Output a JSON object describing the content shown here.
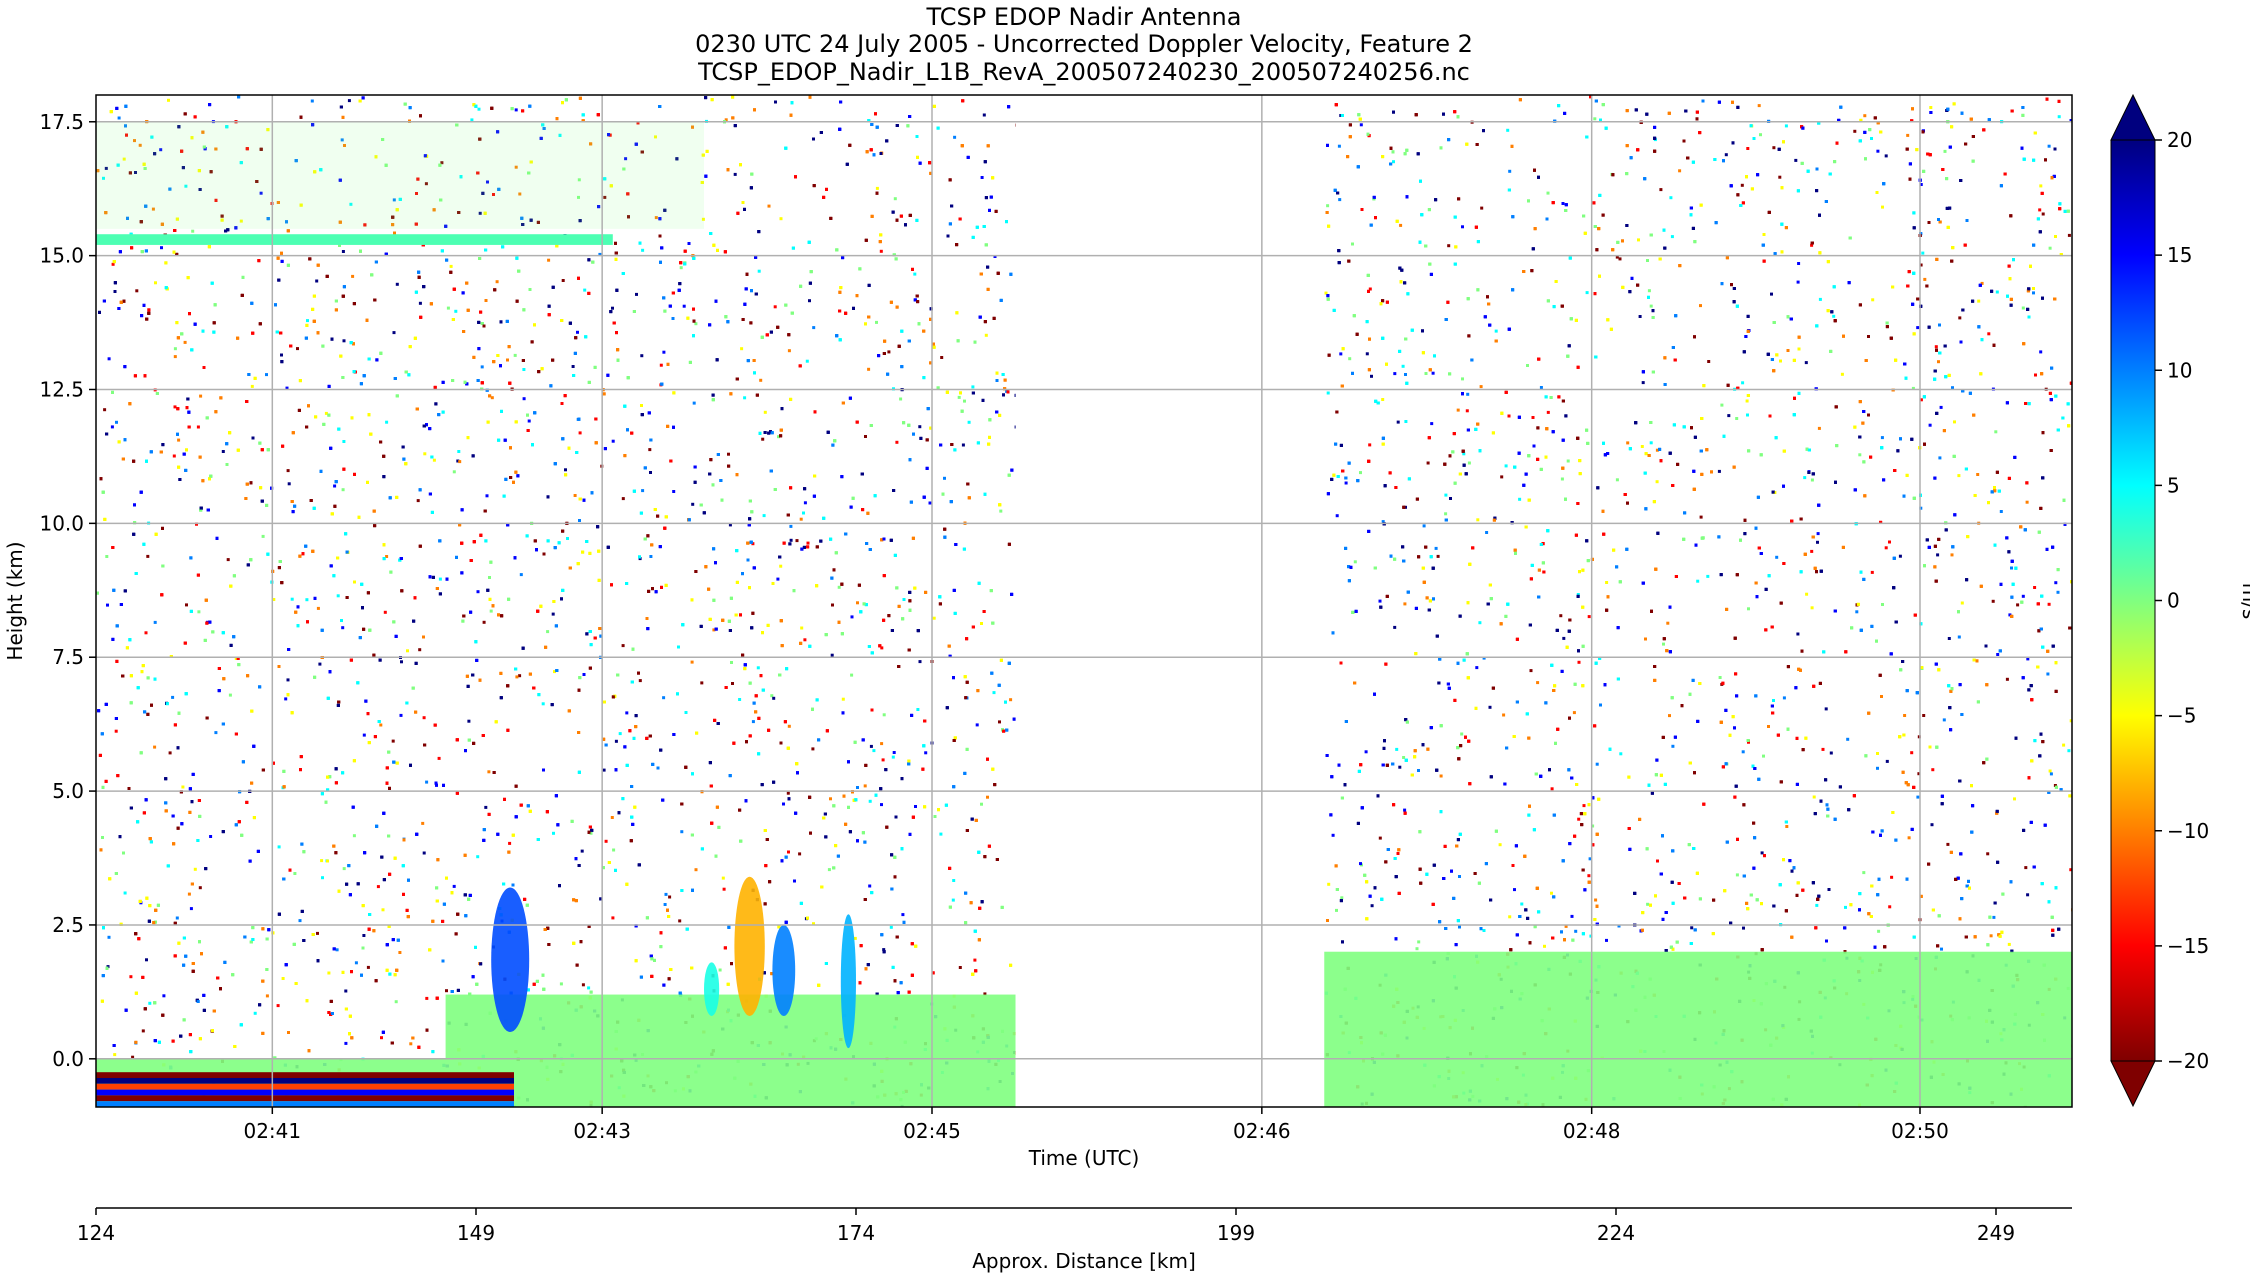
{
  "chart_data": {
    "type": "heatmap",
    "title_lines": [
      "TCSP EDOP Nadir Antenna",
      "0230 UTC 24 July 2005 - Uncorrected Doppler Velocity, Feature 2",
      "TCSP_EDOP_Nadir_L1B_RevA_200507240230_200507240256.nc"
    ],
    "ylabel": "Height (km)",
    "xlabel": "Time (UTC)",
    "x2label": "Approx. Distance [km]",
    "ylim": [
      -0.9,
      18.0
    ],
    "y_ticks": [
      {
        "value": -0.0,
        "label": "0.0"
      },
      {
        "value": 2.5,
        "label": "2.5"
      },
      {
        "value": 5.0,
        "label": "5.0"
      },
      {
        "value": 7.5,
        "label": "7.5"
      },
      {
        "value": 10.0,
        "label": "10.0"
      },
      {
        "value": 12.5,
        "label": "12.5"
      },
      {
        "value": 15.0,
        "label": "15.0"
      },
      {
        "value": 17.5,
        "label": "17.5"
      }
    ],
    "x_range_distance_km": [
      124,
      254
    ],
    "x_time_ticks": [
      {
        "distance_km": 135.6,
        "label": "02:41"
      },
      {
        "distance_km": 157.3,
        "label": "02:43"
      },
      {
        "distance_km": 179.0,
        "label": "02:45"
      },
      {
        "distance_km": 200.7,
        "label": "02:46"
      },
      {
        "distance_km": 222.4,
        "label": "02:48"
      },
      {
        "distance_km": 244.0,
        "label": "02:50"
      }
    ],
    "x_distance_ticks": [
      {
        "value": 124,
        "label": "124"
      },
      {
        "value": 149,
        "label": "149"
      },
      {
        "value": 174,
        "label": "174"
      },
      {
        "value": 199,
        "label": "199"
      },
      {
        "value": 224,
        "label": "224"
      },
      {
        "value": 249,
        "label": "249"
      }
    ],
    "data_gap_km": [
      184.5,
      204.8
    ],
    "grid": true,
    "colorbar": {
      "label": "m/s",
      "colormap": "jet_r",
      "range": [
        -20,
        20
      ],
      "extend": "both",
      "ticks": [
        {
          "value": 20,
          "label": "20"
        },
        {
          "value": 15,
          "label": "15"
        },
        {
          "value": 10,
          "label": "10"
        },
        {
          "value": 5,
          "label": "5"
        },
        {
          "value": 0,
          "label": "0"
        },
        {
          "value": -5,
          "label": "−5"
        },
        {
          "value": -10,
          "label": "−10"
        },
        {
          "value": -15,
          "label": "−15"
        },
        {
          "value": -20,
          "label": "−20"
        }
      ],
      "colors": [
        "#7f0000",
        "#ff0000",
        "#ff7f00",
        "#ffff00",
        "#80ff80",
        "#00ffff",
        "#007fff",
        "#0000ff",
        "#00007f"
      ]
    },
    "features": [
      {
        "name": "surface_band",
        "x_km": [
          124,
          184.5
        ],
        "y_km": [
          -0.9,
          0.0
        ],
        "velocity": 0
      },
      {
        "name": "surface_band",
        "x_km": [
          204.8,
          254
        ],
        "y_km": [
          -0.9,
          2.0
        ],
        "velocity": 0
      },
      {
        "name": "boundary_layer",
        "x_km": [
          147,
          184.5
        ],
        "y_km": [
          0.0,
          1.2
        ],
        "velocity": 0
      },
      {
        "name": "surface_stripes",
        "x_km": [
          124,
          151.5
        ],
        "y_km": [
          -0.9,
          -0.25
        ],
        "velocity": -20
      },
      {
        "name": "convective_cell",
        "x_km": [
          150.0,
          152.5
        ],
        "y_km": [
          0.5,
          3.2
        ],
        "velocity": 12
      },
      {
        "name": "convective_cell",
        "x_km": [
          166.0,
          168.0
        ],
        "y_km": [
          0.8,
          3.4
        ],
        "velocity": -8
      },
      {
        "name": "convective_cell",
        "x_km": [
          168.5,
          170.0
        ],
        "y_km": [
          0.8,
          2.5
        ],
        "velocity": 10
      },
      {
        "name": "convective_cell",
        "x_km": [
          173.0,
          174.0
        ],
        "y_km": [
          0.2,
          2.7
        ],
        "velocity": 8
      },
      {
        "name": "convective_cell",
        "x_km": [
          164.0,
          165.0
        ],
        "y_km": [
          0.8,
          1.8
        ],
        "velocity": 4
      },
      {
        "name": "anvil_layer",
        "x_km": [
          124,
          158.0
        ],
        "y_km": [
          15.2,
          15.4
        ],
        "velocity": 2
      },
      {
        "name": "noise_layer",
        "x_km": [
          124,
          164.0
        ],
        "y_km": [
          15.5,
          17.5
        ],
        "velocity": 0
      }
    ]
  }
}
